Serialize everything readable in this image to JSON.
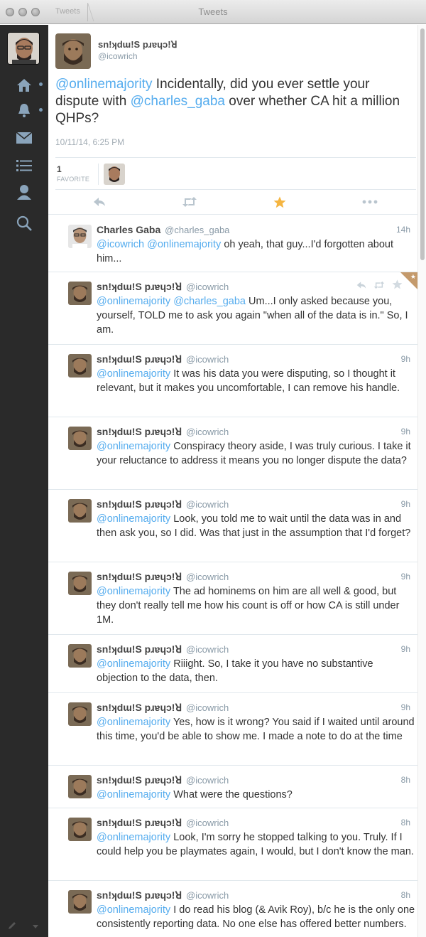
{
  "window": {
    "title": "Tweets",
    "back_label": "Tweets"
  },
  "colors": {
    "link": "#55acee",
    "sidebar": "#2a2a2a",
    "favorite": "#f5b541",
    "fav_corner": "#c49a6c"
  },
  "sidebar": {
    "items": [
      {
        "icon": "home-icon"
      },
      {
        "icon": "notifications-icon"
      },
      {
        "icon": "messages-icon"
      },
      {
        "icon": "lists-icon"
      },
      {
        "icon": "profile-icon"
      },
      {
        "icon": "search-icon"
      }
    ]
  },
  "detail": {
    "name": "sn!ʞdɯ!S pɹɐɥɔ!ꓤ",
    "handle": "@icowrich",
    "mention1": "@onlinemajority",
    "text1": " Incidentally, did you ever settle your dispute with ",
    "mention2": "@charles_gaba",
    "text2": " over whether CA hit a million QHPs?",
    "timestamp": "10/11/14, 6:25 PM",
    "favorites_count": "1",
    "favorites_label": "FAVORITE"
  },
  "tweets": [
    {
      "name": "Charles Gaba",
      "handle": "@charles_gaba",
      "time": "14h",
      "mentions": "@icowrich @onlinemajority",
      "text": " oh yeah, that guy...I'd forgotten about him..."
    },
    {
      "name": "sn!ʞdɯ!S pɹɐɥɔ!ꓤ",
      "handle": "@icowrich",
      "time": "",
      "mentions": "@onlinemajority @charles_gaba",
      "text": " Um...I only asked because you, yourself, TOLD me to ask you again \"when all of the data is in.\" So, I am."
    },
    {
      "name": "sn!ʞdɯ!S pɹɐɥɔ!ꓤ",
      "handle": "@icowrich",
      "time": "9h",
      "mentions": "@onlinemajority",
      "text": " It was his data you were disputing, so I thought it relevant, but it makes you uncomfortable, I can remove his handle."
    },
    {
      "name": "sn!ʞdɯ!S pɹɐɥɔ!ꓤ",
      "handle": "@icowrich",
      "time": "9h",
      "mentions": "@onlinemajority",
      "text": " Conspiracy theory aside, I was truly curious. I take it your reluctance to address it means you no longer dispute the data?"
    },
    {
      "name": "sn!ʞdɯ!S pɹɐɥɔ!ꓤ",
      "handle": "@icowrich",
      "time": "9h",
      "mentions": "@onlinemajority",
      "text": " Look, you told me to wait until the data was in and then ask you, so I did. Was that just in the assumption that I'd forget?"
    },
    {
      "name": "sn!ʞdɯ!S pɹɐɥɔ!ꓤ",
      "handle": "@icowrich",
      "time": "9h",
      "mentions": "@onlinemajority",
      "text": " The ad hominems on him are all well & good, but they don't really tell me how his count is off or how CA is still under 1M."
    },
    {
      "name": "sn!ʞdɯ!S pɹɐɥɔ!ꓤ",
      "handle": "@icowrich",
      "time": "9h",
      "mentions": "@onlinemajority",
      "text": " Riiight. So, I take it you have no substantive objection to the data, then."
    },
    {
      "name": "sn!ʞdɯ!S pɹɐɥɔ!ꓤ",
      "handle": "@icowrich",
      "time": "9h",
      "mentions": "@onlinemajority",
      "text": " Yes, how is it wrong? You said if I waited until around this time, you'd be able to show me. I made a note to do at the time"
    },
    {
      "name": "sn!ʞdɯ!S pɹɐɥɔ!ꓤ",
      "handle": "@icowrich",
      "time": "8h",
      "mentions": "@onlinemajority",
      "text": " What were the questions?"
    },
    {
      "name": "sn!ʞdɯ!S pɹɐɥɔ!ꓤ",
      "handle": "@icowrich",
      "time": "8h",
      "mentions": "@onlinemajority",
      "text": " Look, I'm sorry he stopped talking to you. Truly. If I could help you be playmates again, I would, but I don't know the man."
    },
    {
      "name": "sn!ʞdɯ!S pɹɐɥɔ!ꓤ",
      "handle": "@icowrich",
      "time": "8h",
      "mentions": "@onlinemajority",
      "text": " I do read his blog (& Avik Roy), b/c he is the only one consistently reporting data. No one else has offered better numbers."
    }
  ]
}
